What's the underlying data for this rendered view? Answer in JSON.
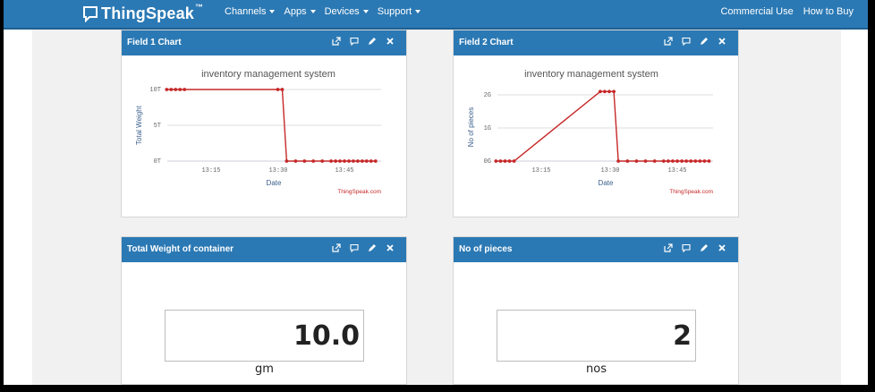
{
  "nav": {
    "brand": "ThingSpeak",
    "brand_mark": "™",
    "menu": [
      {
        "label": "Channels"
      },
      {
        "label": "Apps"
      },
      {
        "label": "Devices"
      },
      {
        "label": "Support"
      }
    ],
    "right": [
      {
        "label": "Commercial Use"
      },
      {
        "label": "How to Buy"
      }
    ]
  },
  "widgets": {
    "field1": {
      "title": "Field 1 Chart",
      "credit": "ThingSpeak.com"
    },
    "field2": {
      "title": "Field 2 Chart",
      "credit": "ThingSpeak.com"
    },
    "weight": {
      "title": "Total Weight of container",
      "value": "10.0",
      "unit": "gm"
    },
    "pieces": {
      "title": "No of pieces",
      "value": "2",
      "unit": "nos"
    }
  },
  "icons": [
    "open-external-icon",
    "comment-icon",
    "pencil-icon",
    "close-icon"
  ],
  "colors": {
    "header": "#2b79b4",
    "line": "#c62828"
  },
  "chart_data": [
    {
      "type": "line",
      "title": "inventory management system",
      "xlabel": "Date",
      "ylabel": "Total Weight",
      "x_ticks": [
        "13:15",
        "13:30",
        "13:45"
      ],
      "y_ticks": [
        "0T",
        "5T",
        "10T"
      ],
      "ylim": [
        0,
        10
      ],
      "series": [
        {
          "x": [
            "13:05",
            "13:06",
            "13:07",
            "13:08",
            "13:09",
            "13:30",
            "13:31",
            "13:32",
            "13:34",
            "13:36",
            "13:38",
            "13:40",
            "13:42",
            "13:43",
            "13:44",
            "13:45",
            "13:46",
            "13:47",
            "13:48",
            "13:49",
            "13:50",
            "13:51",
            "13:52"
          ],
          "values": [
            10,
            10,
            10,
            10,
            10,
            10,
            10,
            0,
            0,
            0,
            0,
            0,
            0,
            0,
            0,
            0,
            0,
            0,
            0,
            0,
            0,
            0,
            0
          ]
        }
      ]
    },
    {
      "type": "line",
      "title": "inventory management system",
      "xlabel": "Date",
      "ylabel": "No of pieces",
      "x_ticks": [
        "13:15",
        "13:30",
        "13:45"
      ],
      "y_ticks": [
        "0G",
        "1G",
        "2G"
      ],
      "ylim": [
        0,
        2.2
      ],
      "series": [
        {
          "x": [
            "13:05",
            "13:06",
            "13:07",
            "13:08",
            "13:09",
            "13:28",
            "13:29",
            "13:30",
            "13:31",
            "13:32",
            "13:34",
            "13:36",
            "13:38",
            "13:40",
            "13:42",
            "13:43",
            "13:44",
            "13:45",
            "13:46",
            "13:47",
            "13:48",
            "13:49",
            "13:50",
            "13:51",
            "13:52"
          ],
          "values": [
            0,
            0,
            0,
            0,
            0,
            2.1,
            2.1,
            2.1,
            2.1,
            0,
            0,
            0,
            0,
            0,
            0,
            0,
            0,
            0,
            0,
            0,
            0,
            0,
            0,
            0,
            0
          ]
        }
      ]
    }
  ]
}
